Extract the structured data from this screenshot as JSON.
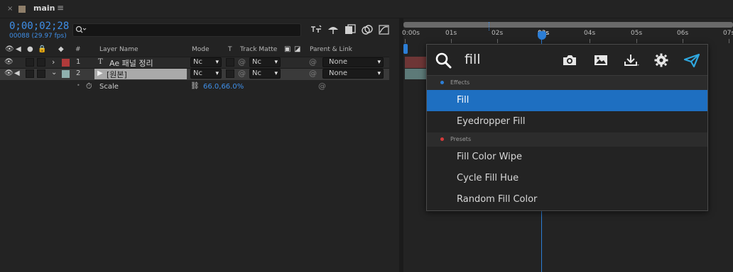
{
  "tab": {
    "close": "×",
    "label": "main",
    "menu": "≡",
    "swatch_color": "#8f7f6a"
  },
  "timecode": {
    "value": "0;00;02;28",
    "frames": "00088 (29.97 fps)"
  },
  "search": {
    "placeholder": "",
    "icon": "search-icon"
  },
  "toolbar_icons": [
    "draft-3d-icon",
    "shy-layers-icon",
    "frame-blending-icon",
    "motion-blur-icon",
    "graph-editor-icon"
  ],
  "columns": {
    "hash": "#",
    "layer_name": "Layer Name",
    "mode": "Mode",
    "t": "T",
    "track_matte": "Track Matte",
    "parent_link": "Parent & Link"
  },
  "layers": [
    {
      "index": "1",
      "type_glyph": "T",
      "name": "Ae 패널 정리",
      "label_color": "#b03a3a",
      "mode": "Nc",
      "matte": "Nc",
      "parent": "None",
      "expanded": false
    },
    {
      "index": "2",
      "type_glyph": "▶",
      "name": "[원본]",
      "label_color": "#8fb0ae",
      "mode": "Nc",
      "matte": "Nc",
      "parent": "None",
      "expanded": true
    }
  ],
  "property": {
    "name": "Scale",
    "value": "66.0,66.0%"
  },
  "ruler": {
    "ticks": [
      "0:00s",
      "01s",
      "02s",
      "03s",
      "04s",
      "05s",
      "06s",
      "07s"
    ]
  },
  "popup": {
    "query": "fill",
    "sections": [
      {
        "title": "Effects",
        "dot_color": "#2c7ed6",
        "items": [
          "Fill",
          "Eyedropper Fill"
        ]
      },
      {
        "title": "Presets",
        "dot_color": "#d63a3a",
        "items": [
          "Fill Color Wipe",
          "Cycle Fill Hue",
          "Random Fill Color"
        ]
      }
    ],
    "selected_item": "Fill",
    "icons": [
      "camera-icon",
      "image-icon",
      "download-icon",
      "settings-icon",
      "plugin-logo-icon"
    ]
  },
  "colors": {
    "accent": "#2c7ed6",
    "timecode": "#3f8fe8",
    "selected_bg": "#1e6fc1"
  }
}
